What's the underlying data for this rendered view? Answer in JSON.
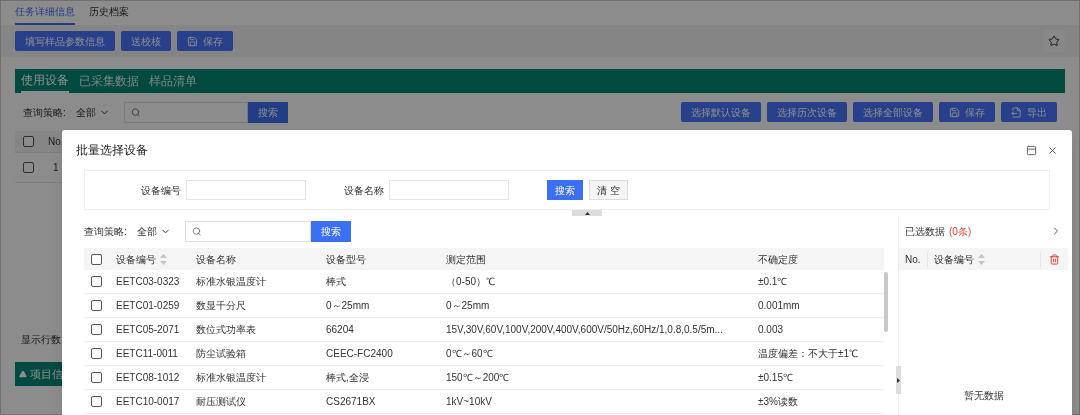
{
  "page_tabs": [
    {
      "label": "任务详细信息",
      "selected": true
    },
    {
      "label": "历史档案",
      "selected": false
    }
  ],
  "toolbar_buttons": [
    {
      "label": "填写样品参数信息",
      "kind": "text"
    },
    {
      "label": "送校核",
      "kind": "text"
    },
    {
      "label": "保存",
      "kind": "save"
    }
  ],
  "section_tabs": [
    {
      "label": "使用设备",
      "selected": true
    },
    {
      "label": "已采集数据",
      "selected": false
    },
    {
      "label": "样品清单",
      "selected": false
    }
  ],
  "query": {
    "label": "查询策略:",
    "strategy": "全部",
    "button": "搜索"
  },
  "action_buttons": [
    {
      "label": "选择默认设备",
      "kind": "text"
    },
    {
      "label": "选择历次设备",
      "kind": "text"
    },
    {
      "label": "选择全部设备",
      "kind": "text"
    },
    {
      "label": "保存",
      "kind": "save"
    },
    {
      "label": "导出",
      "kind": "export"
    }
  ],
  "background_table": {
    "all_checked": false,
    "columns": [
      "No."
    ],
    "rows": [
      {
        "no": "1",
        "checked": false
      }
    ]
  },
  "footer_label": "显示行数",
  "collapsed_section": {
    "label": "项目信",
    "expanded": true
  },
  "dialog": {
    "title": "批量选择设备",
    "filters": [
      {
        "label": "设备编号"
      },
      {
        "label": "设备名称"
      }
    ],
    "search_button": "搜索",
    "clear_button": "清 空",
    "query": {
      "label": "查询策略:",
      "strategy": "全部",
      "button": "搜索"
    },
    "table": {
      "all_checked": false,
      "columns": [
        {
          "label": "设备编号",
          "sortable": true
        },
        {
          "label": "设备名称",
          "sortable": false
        },
        {
          "label": "设备型号",
          "sortable": false
        },
        {
          "label": "测定范围",
          "sortable": false
        },
        {
          "label": "不确定度",
          "sortable": false
        }
      ],
      "rows": [
        {
          "checked": false,
          "cells": [
            "EETC03-0323",
            "标准水银温度计",
            "棒式",
            "（0-50）℃",
            "±0.1℃"
          ]
        },
        {
          "checked": false,
          "cells": [
            "EETC01-0259",
            "数显千分尺",
            "0～25mm",
            "0～25mm",
            "0.001mm"
          ]
        },
        {
          "checked": false,
          "cells": [
            "EETC05-2071",
            "数位式功率表",
            "66204",
            "15V,30V,60V,100V,200V,400V,600V/50Hz,60Hz/1,0.8,0.5/5m...",
            "0.003"
          ]
        },
        {
          "checked": false,
          "cells": [
            "EETC11-0011",
            "防尘试验箱",
            "CEEC-FC2400",
            "0℃～60℃",
            "温度偏差：不大于±1℃"
          ]
        },
        {
          "checked": false,
          "cells": [
            "EETC08-1012",
            "标准水银温度计",
            "棒式,全浸",
            "150℃～200℃",
            "±0.15℃"
          ]
        },
        {
          "checked": false,
          "cells": [
            "EETC10-0017",
            "耐压测试仪",
            "CS2671BX",
            "1kV~10kV",
            "±3%读数"
          ]
        }
      ]
    },
    "selected_panel": {
      "title": "已选数据",
      "count": "(0条)",
      "columns": [
        {
          "label": "No.",
          "sortable": false
        },
        {
          "label": "设备编号",
          "sortable": true
        }
      ],
      "empty": "暂无数据"
    }
  }
}
